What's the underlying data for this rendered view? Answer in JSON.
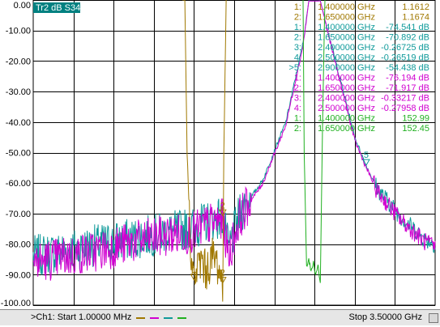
{
  "trace_badge": "Tr2 dB S34",
  "status": {
    "start": ">Ch1: Start  1.00000 MHz",
    "stop": "Stop  3.50000 GHz"
  },
  "colors": {
    "background": "#ffffff",
    "grid": "#000000",
    "badge": "#008080",
    "orange": "#a07800",
    "teal": "#0f9a9a",
    "magenta": "#d000d0",
    "green": "#20b020"
  },
  "markers_table": [
    {
      "label": "1:",
      "freq": "1.400000 GHz",
      "value": "1.1612",
      "color": "orange"
    },
    {
      "label": "2:",
      "freq": "1.650000 GHz",
      "value": "1.1674",
      "color": "orange"
    },
    {
      "label": "1:",
      "freq": "1.400000 GHz",
      "value": "-74.541 dB",
      "color": "teal"
    },
    {
      "label": "2:",
      "freq": "1.650000 GHz",
      "value": "-70.892 dB",
      "color": "teal"
    },
    {
      "label": "3:",
      "freq": "2.400000 GHz",
      "value": "-0.26725 dB",
      "color": "teal"
    },
    {
      "label": "4:",
      "freq": "2.500000 GHz",
      "value": "-0.26519 dB",
      "color": "teal"
    },
    {
      "label": ">5:",
      "freq": "2.900000 GHz",
      "value": "-54.438 dB",
      "color": "teal"
    },
    {
      "label": "1:",
      "freq": "1.400000 GHz",
      "value": "-76.194 dB",
      "color": "magenta"
    },
    {
      "label": "2:",
      "freq": "1.650000 GHz",
      "value": "-71.917 dB",
      "color": "magenta"
    },
    {
      "label": "3:",
      "freq": "2.400000 GHz",
      "value": "-0.33217 dB",
      "color": "magenta"
    },
    {
      "label": "4:",
      "freq": "2.500000 GHz",
      "value": "-0.27958 dB",
      "color": "magenta"
    },
    {
      "label": "1:",
      "freq": "1.400000 GHz",
      "value": "152.99",
      "color": "green"
    },
    {
      "label": "2:",
      "freq": "1.650000 GHz",
      "value": "152.45",
      "color": "green"
    }
  ],
  "chart_data": {
    "type": "line",
    "title": "",
    "xlabel": "",
    "ylabel": "",
    "x_range_hz": [
      1000000,
      3500000000
    ],
    "ylim": [
      -100,
      0
    ],
    "y_ticks": [
      0,
      -10,
      -20,
      -30,
      -40,
      -50,
      -60,
      -70,
      -80,
      -90,
      -100
    ],
    "y_tick_labels": [
      "0.00",
      "-10.00",
      "-20.00",
      "-30.00",
      "-40.00",
      "-50.00",
      "-60.00",
      "-70.00",
      "-80.00",
      "-90.00",
      "-100.00"
    ],
    "x_divisions": 10,
    "grid": true,
    "series": [
      {
        "color": "teal",
        "x": [
          0.0,
          0.3,
          0.6,
          0.9,
          1.2,
          1.4,
          1.5,
          1.6,
          1.65,
          1.7,
          1.8,
          2.0,
          2.2,
          2.35,
          2.4,
          2.45,
          2.5,
          2.6,
          2.8,
          2.9,
          3.0,
          3.2,
          3.4,
          3.5
        ],
        "y": [
          -84,
          -82,
          -80,
          -78,
          -76,
          -74.5,
          -73,
          -71.5,
          -70.9,
          -82,
          -70,
          -59,
          -40,
          -14,
          -0.27,
          -0.3,
          -0.27,
          -15,
          -45,
          -54.4,
          -62,
          -71,
          -78,
          -80
        ]
      },
      {
        "color": "magenta",
        "x": [
          0.0,
          0.3,
          0.6,
          0.9,
          1.2,
          1.4,
          1.5,
          1.6,
          1.65,
          1.7,
          1.8,
          2.0,
          2.2,
          2.35,
          2.4,
          2.45,
          2.5,
          2.6,
          2.8,
          2.9,
          3.0,
          3.2,
          3.4,
          3.5
        ],
        "y": [
          -86,
          -84,
          -82,
          -79,
          -77,
          -76.2,
          -74,
          -72.5,
          -71.9,
          -84,
          -71,
          -60,
          -41,
          -15,
          -0.33,
          -0.35,
          -0.28,
          -16,
          -46,
          -55,
          -63,
          -72,
          -79,
          -81
        ]
      },
      {
        "color": "orange",
        "x": [
          1.3,
          1.32,
          1.34,
          1.36,
          1.38,
          1.4,
          1.43,
          1.47,
          1.5,
          1.53,
          1.56,
          1.6,
          1.63,
          1.65,
          1.66,
          1.68
        ],
        "y": [
          0,
          0,
          -50,
          -70,
          -87,
          -92,
          -88,
          -85,
          -89,
          -87,
          -84,
          -86,
          -90,
          -93,
          -50,
          0
        ]
      },
      {
        "color": "green",
        "x": [
          2.35,
          2.36,
          2.38,
          2.4,
          2.42,
          2.44,
          2.46,
          2.48,
          2.5,
          2.52,
          2.54
        ],
        "y": [
          0,
          -50,
          -87,
          -85,
          -89,
          -86,
          -90,
          -87,
          -93,
          -40,
          0
        ]
      }
    ],
    "markers_on_plot": [
      {
        "label": "2",
        "x": 1.65,
        "y": -70.9,
        "color": "orange"
      },
      {
        "label": "2",
        "x": 1.65,
        "y": -93,
        "color": "orange"
      },
      {
        "label": "1",
        "x": 1.4,
        "y": -92,
        "color": "orange"
      },
      {
        "label": "3",
        "x": 2.4,
        "y": -0.3,
        "color": "teal"
      },
      {
        "label": "4",
        "x": 2.5,
        "y": -0.3,
        "color": "teal"
      },
      {
        "label": "5",
        "x": 2.9,
        "y": -54.4,
        "color": "teal"
      }
    ]
  }
}
